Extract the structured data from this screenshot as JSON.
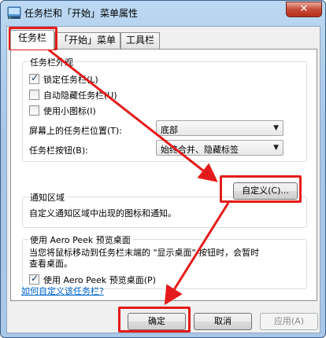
{
  "window": {
    "title": "任务栏和「开始」菜单属性",
    "close_label": "✕"
  },
  "icons": {
    "app": "taskbar-properties-icon",
    "close": "close-icon",
    "check": "check-icon",
    "dropdown": "chevron-down-icon"
  },
  "tabs": [
    {
      "label": "任务栏",
      "active": true
    },
    {
      "label": "「开始」菜单",
      "active": false
    },
    {
      "label": "工具栏",
      "active": false
    }
  ],
  "appearance": {
    "title": "任务栏外观",
    "lock": {
      "label": "锁定任务栏(L)",
      "checked": true
    },
    "autohide": {
      "label": "自动隐藏任务栏(U)",
      "checked": false
    },
    "small_icons": {
      "label": "使用小图标(I)",
      "checked": false
    },
    "position_label": "屏幕上的任务栏位置(T):",
    "position_value": "底部",
    "buttons_label": "任务栏按钮(B):",
    "buttons_value": "始终合并、隐藏标签"
  },
  "notification": {
    "title": "通知区域",
    "description": "自定义通知区域中出现的图标和通知。",
    "customize_button": "自定义(C)..."
  },
  "aero_peek": {
    "title": "使用 Aero Peek 预览桌面",
    "description_line1": "当您将鼠标移动到任务栏末端的 \"显示桌面\" 按钮时，会暂时",
    "description_line2": "查看桌面。",
    "checkbox": {
      "label": "使用 Aero Peek 预览桌面(P)",
      "checked": true
    }
  },
  "help_link": "如何自定义该任务栏?",
  "footer": {
    "ok": "确定",
    "cancel": "取消",
    "apply": "应用(A)"
  },
  "annotation_color": "#e41b1b"
}
